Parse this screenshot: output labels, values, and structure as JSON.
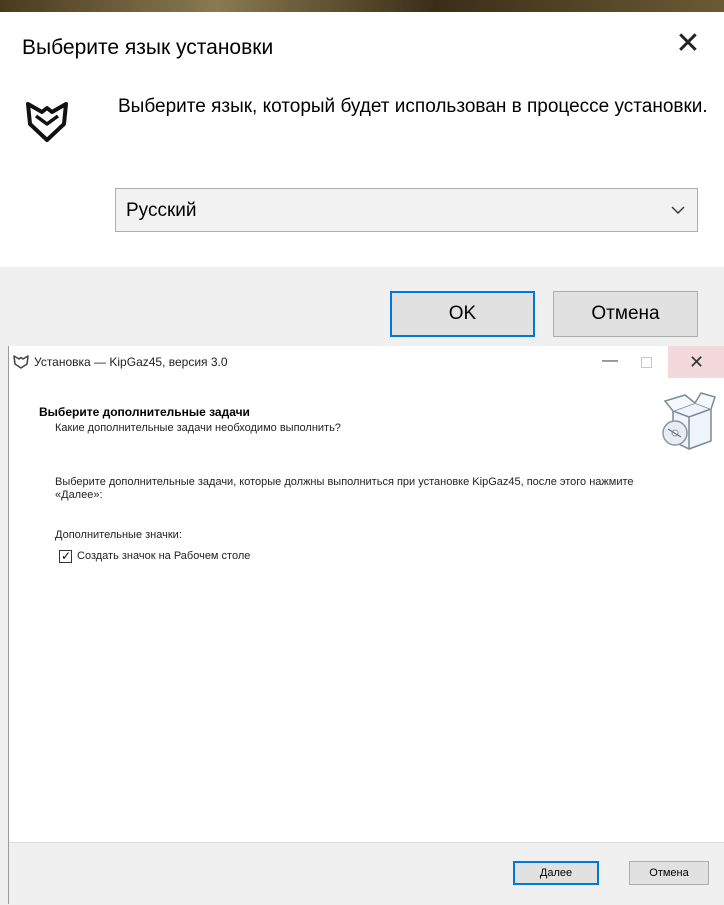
{
  "language_dialog": {
    "title": "Выберите язык установки",
    "close_glyph": "✕",
    "message": "Выберите язык, который будет использован в процессе установки.",
    "language_select": {
      "value": "Русский"
    },
    "buttons": {
      "ok": "OK",
      "cancel": "Отмена"
    },
    "accent_color": "#0078d7",
    "icons": [
      "app-logo-icon",
      "chevron-down-icon",
      "close-icon"
    ]
  },
  "setup_wizard": {
    "window_title": "Установка — KipGaz45, версия 3.0",
    "window_controls": {
      "minimize": "—",
      "close": "✕"
    },
    "heading": "Выберите дополнительные задачи",
    "subheading": "Какие дополнительные задачи необходимо выполнить?",
    "description": "Выберите дополнительные задачи, которые должны выполниться при установке KipGaz45, после этого нажмите «Далее»:",
    "group_label": "Дополнительные значки:",
    "tasks": [
      {
        "label": "Создать значок на Рабочем столе",
        "checked": true,
        "check_glyph": "✓"
      }
    ],
    "buttons": {
      "next": "Далее",
      "cancel": "Отмена"
    },
    "icons": [
      "app-icon",
      "setup-box-icon",
      "checkbox-icon"
    ]
  }
}
